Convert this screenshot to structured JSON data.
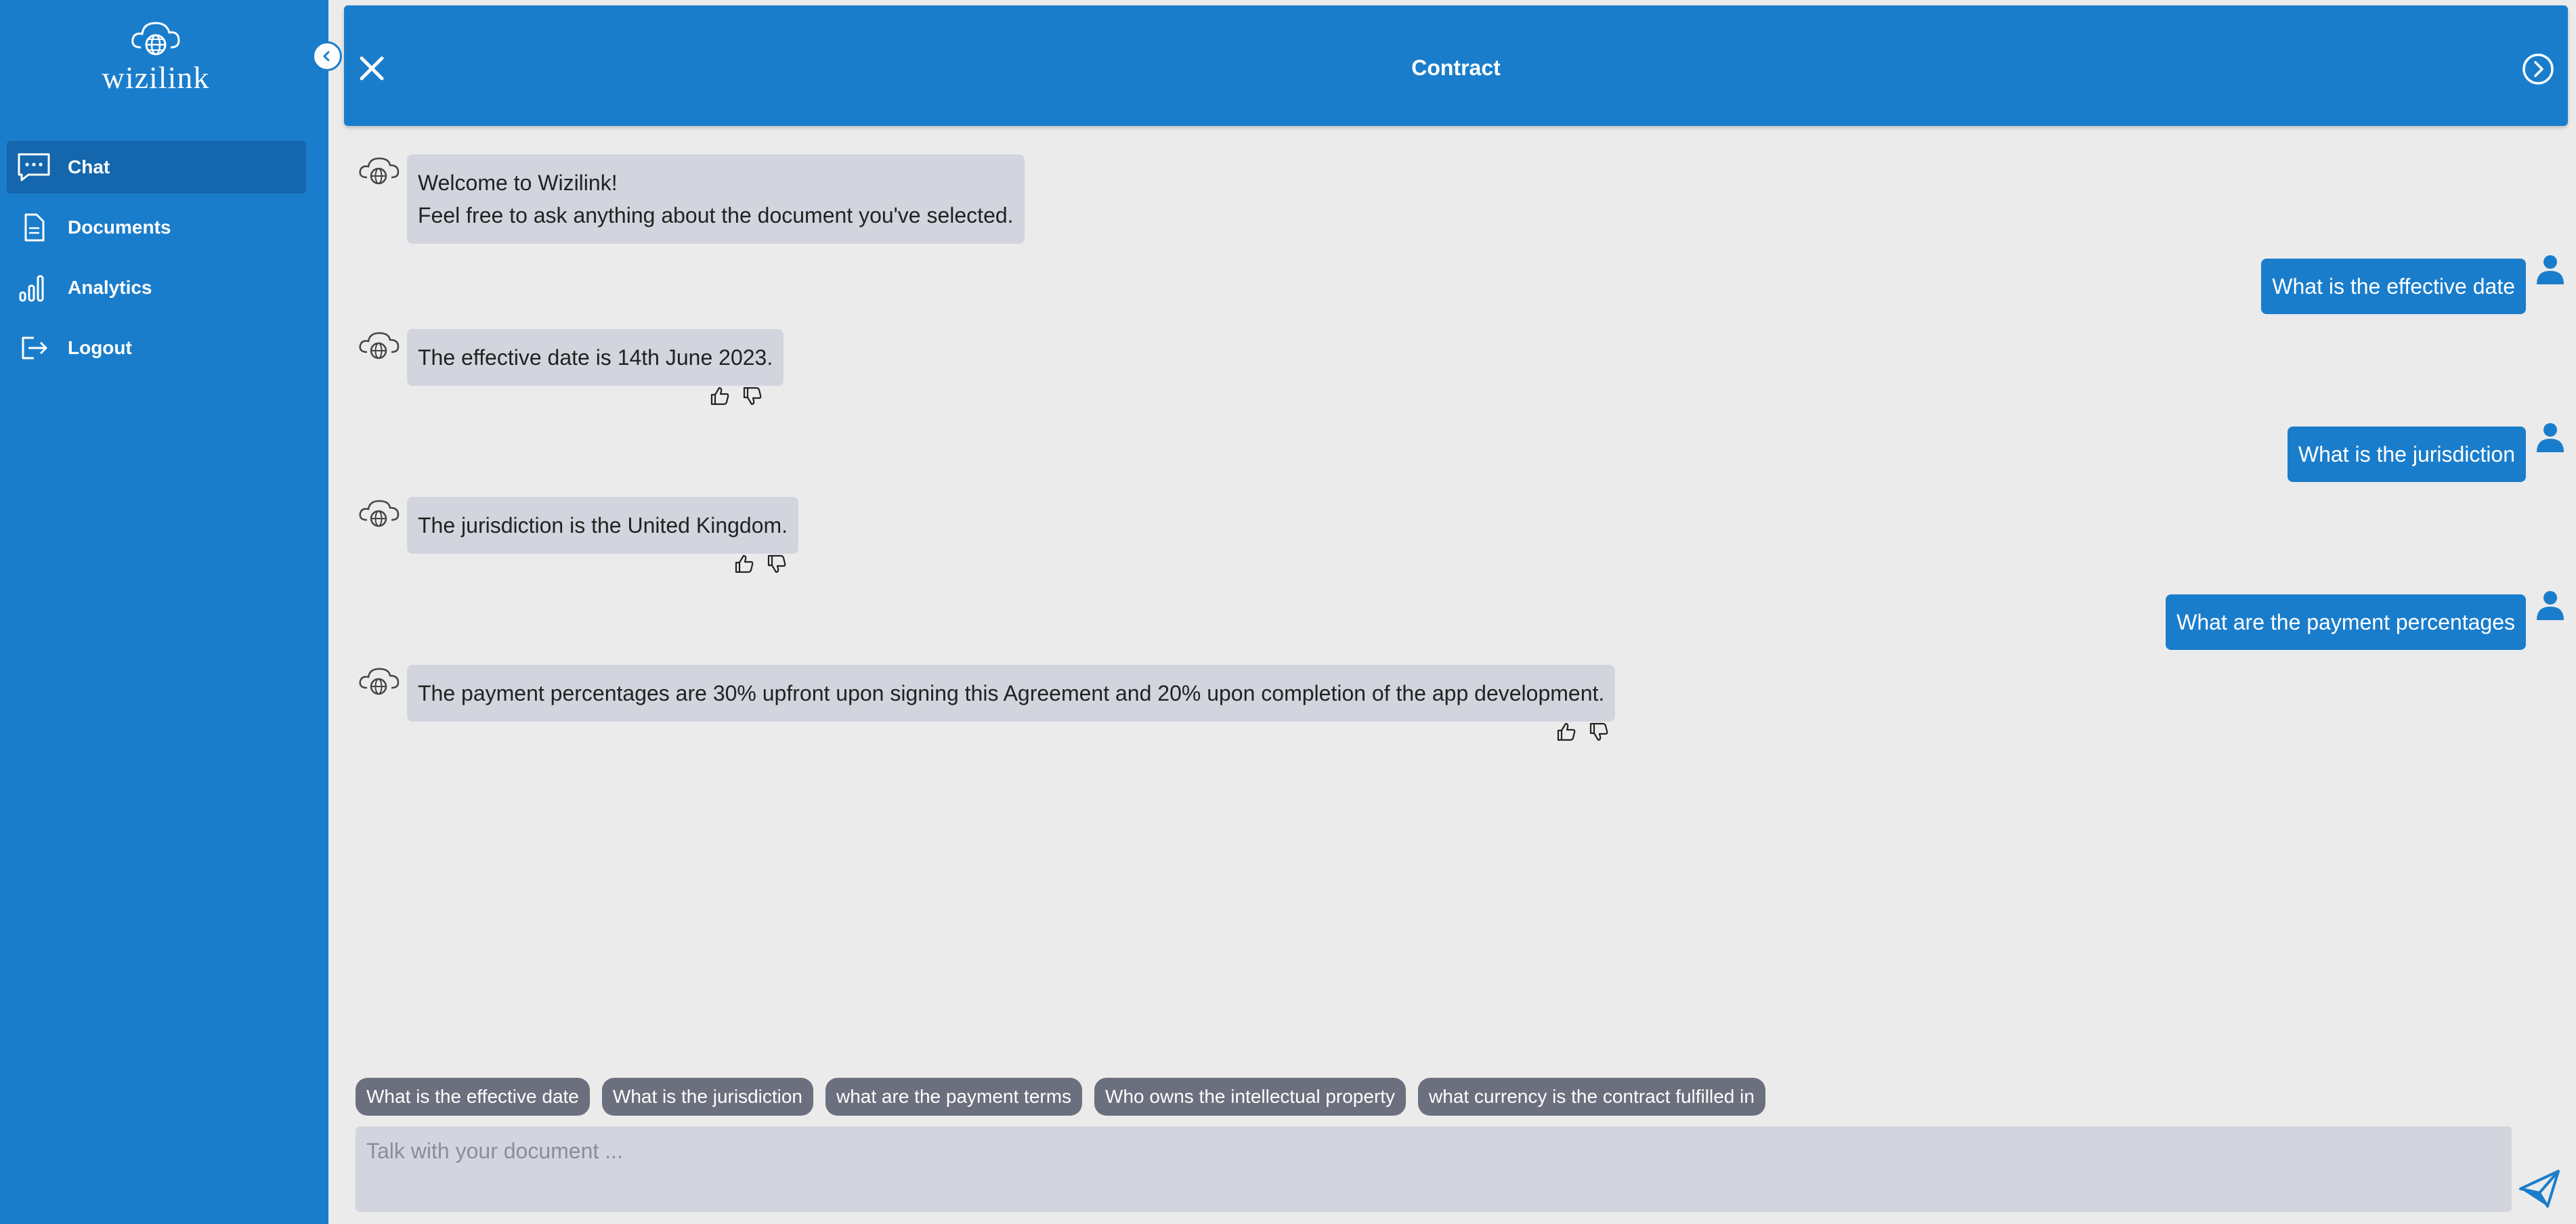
{
  "brand": {
    "name": "wizilink"
  },
  "sidebar": {
    "items": [
      {
        "label": "Chat",
        "icon": "chat-icon",
        "active": true
      },
      {
        "label": "Documents",
        "icon": "document-icon",
        "active": false
      },
      {
        "label": "Analytics",
        "icon": "analytics-icon",
        "active": false
      },
      {
        "label": "Logout",
        "icon": "logout-icon",
        "active": false
      }
    ]
  },
  "header": {
    "title": "Contract"
  },
  "messages": [
    {
      "role": "bot",
      "lines": [
        "Welcome to Wizilink!",
        "Feel free to ask anything about the document you've selected."
      ]
    },
    {
      "role": "user",
      "text": "What is the effective date"
    },
    {
      "role": "bot",
      "text": "The effective date is 14th June 2023."
    },
    {
      "role": "user",
      "text": "What is the jurisdiction"
    },
    {
      "role": "bot",
      "text": "The jurisdiction is the United Kingdom."
    },
    {
      "role": "user",
      "text": "What are the payment percentages"
    },
    {
      "role": "bot",
      "text": "The payment percentages are 30% upfront upon signing this Agreement and 20% upon completion of the app development."
    }
  ],
  "suggestions": [
    "What is the effective date",
    "What is the jurisdiction",
    "what are the payment terms",
    "Who owns the intellectual property",
    "what currency is the contract fulfilled in"
  ],
  "composer": {
    "placeholder": "Talk with your document ..."
  },
  "colors": {
    "primary": "#1a7dcb",
    "background": "#ebebeb",
    "bot_bubble": "#d2d5dd",
    "chip": "#6c6f7d"
  }
}
